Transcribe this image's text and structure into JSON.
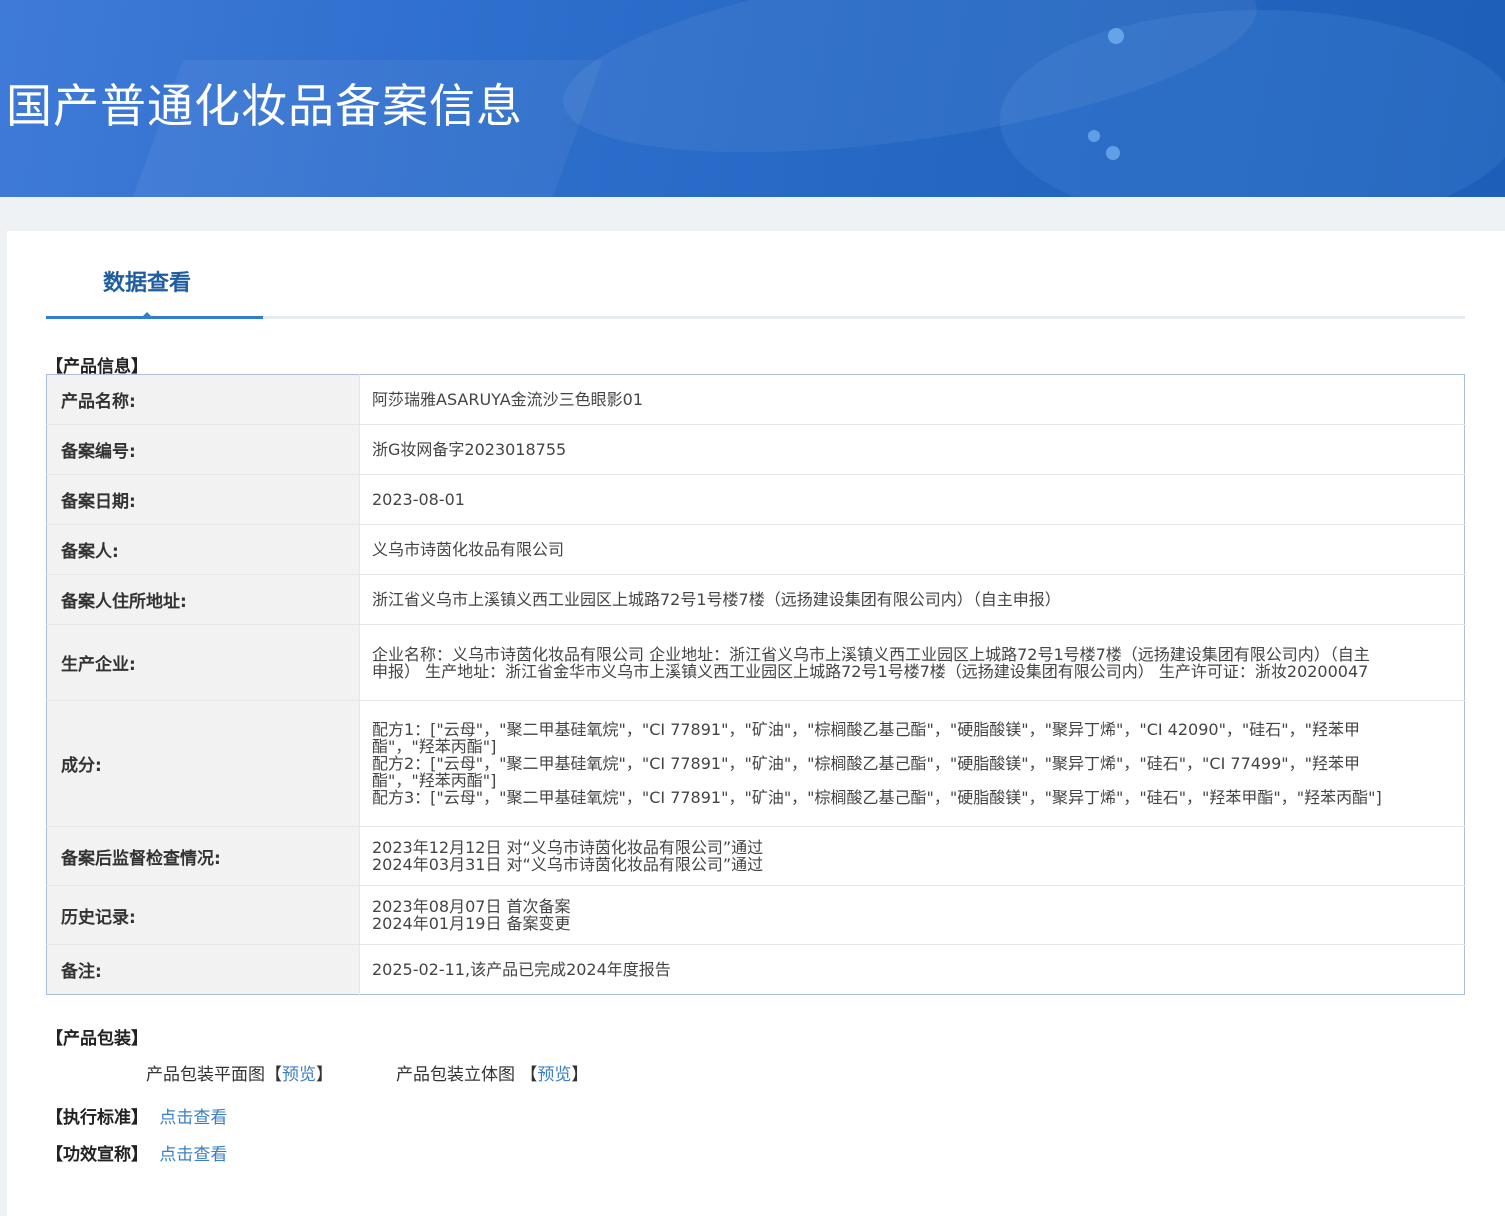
{
  "header": {
    "title": "国产普通化妆品备案信息"
  },
  "tabs": [
    {
      "label": "数据查看"
    }
  ],
  "product_section": {
    "heading": "【产品信息】"
  },
  "info_rows": [
    {
      "key": "产品名称:",
      "value": "阿莎瑞雅ASARUYA金流沙三色眼影01"
    },
    {
      "key": "备案编号:",
      "value": "浙G妆网备字2023018755"
    },
    {
      "key": "备案日期:",
      "value": "2023-08-01"
    },
    {
      "key": "备案人:",
      "value": "义乌市诗茵化妆品有限公司"
    },
    {
      "key": "备案人住所地址:",
      "value": "浙江省义乌市上溪镇义西工业园区上城路72号1号楼7楼（远扬建设集团有限公司内）（自主申报）"
    },
    {
      "key": "生产企业:",
      "value": "企业名称：义乌市诗茵化妆品有限公司 企业地址：浙江省义乌市上溪镇义西工业园区上城路72号1号楼7楼（远扬建设集团有限公司内）（自主申报） 生产地址：浙江省金华市义乌市上溪镇义西工业园区上城路72号1号楼7楼（远扬建设集团有限公司内） 生产许可证：浙妆20200047"
    },
    {
      "key": "成分:",
      "lines": [
        "配方1：[\"云母\"，\"聚二甲基硅氧烷\"，\"CI 77891\"，\"矿油\"，\"棕榈酸乙基己酯\"，\"硬脂酸镁\"，\"聚异丁烯\"，\"CI 42090\"，\"硅石\"，\"羟苯甲酯\"，\"羟苯丙酯\"]",
        "配方2：[\"云母\"，\"聚二甲基硅氧烷\"，\"CI 77891\"，\"矿油\"，\"棕榈酸乙基己酯\"，\"硬脂酸镁\"，\"聚异丁烯\"，\"硅石\"，\"CI 77499\"，\"羟苯甲酯\"，\"羟苯丙酯\"]",
        "配方3：[\"云母\"，\"聚二甲基硅氧烷\"，\"CI 77891\"，\"矿油\"，\"棕榈酸乙基己酯\"，\"硬脂酸镁\"，\"聚异丁烯\"，\"硅石\"，\"羟苯甲酯\"，\"羟苯丙酯\"]"
      ]
    },
    {
      "key": "备案后监督检查情况:",
      "lines": [
        "2023年12月12日 对“义乌市诗茵化妆品有限公司”通过",
        "2024年03月31日 对“义乌市诗茵化妆品有限公司”通过"
      ]
    },
    {
      "key": "历史记录:",
      "lines": [
        "2023年08月07日 首次备案",
        "2024年01月19日 备案变更"
      ]
    },
    {
      "key": "备注:",
      "value": "2025-02-11,该产品已完成2024年度报告"
    }
  ],
  "package_section": {
    "heading": "【产品包装】",
    "flat_label": "产品包装平面图【",
    "flat_link": "预览",
    "flat_close": "】",
    "solid_label": "产品包装立体图 【",
    "solid_link": "预览",
    "solid_close": "】"
  },
  "standard": {
    "heading": "【执行标准】",
    "link": "点击查看"
  },
  "efficacy": {
    "heading": "【功效宣称】",
    "link": "点击查看"
  }
}
